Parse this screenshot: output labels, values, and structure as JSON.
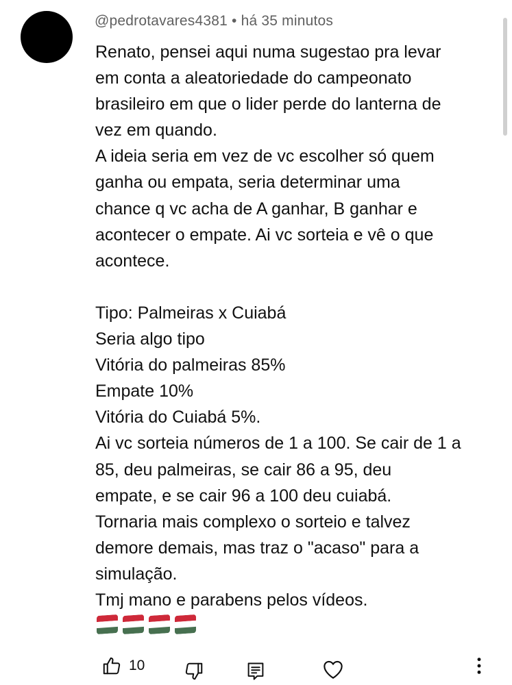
{
  "comment": {
    "author": "@pedrotavares4381",
    "separator": "•",
    "time": "há 35 minutos",
    "text": "Renato, pensei aqui numa sugestao pra levar\nem conta a aleatoriedade do campeonato\nbrasileiro em que o lider perde do lanterna de\nvez em quando.\nA ideia seria em vez de vc escolher só quem\nganha ou empata, seria determinar uma\nchance q vc acha de A ganhar, B ganhar e\nacontecer o empate. Ai vc sorteia e vê o que\nacontece.\n\nTipo: Palmeiras x Cuiabá\nSeria algo tipo\nVitória do palmeiras 85%\nEmpate 10%\nVitória do Cuiabá 5%.\nAi vc sorteia números de 1 a 100. Se cair de 1 a\n85, deu palmeiras, se cair 86 a 95, deu\nempate, e se cair 96 a 100 deu cuiabá.\nTornaria mais complexo o sorteio e talvez\ndemore demais, mas traz o \"acaso\" para a\nsimulação.\nTmj mano e parabens pelos vídeos.",
    "flags": [
      "hungary-flag",
      "hungary-flag",
      "hungary-flag",
      "hungary-flag"
    ],
    "flag_colors": [
      "#ce2939",
      "#ffffff",
      "#477050"
    ]
  },
  "actions": {
    "like_count": "10",
    "icons": [
      "thumbs-up-icon",
      "thumbs-down-icon",
      "reply-icon",
      "heart-icon",
      "more-vertical-icon"
    ]
  },
  "colors": {
    "text": "#111111",
    "meta": "#606060",
    "icon": "#0f0f0f"
  }
}
